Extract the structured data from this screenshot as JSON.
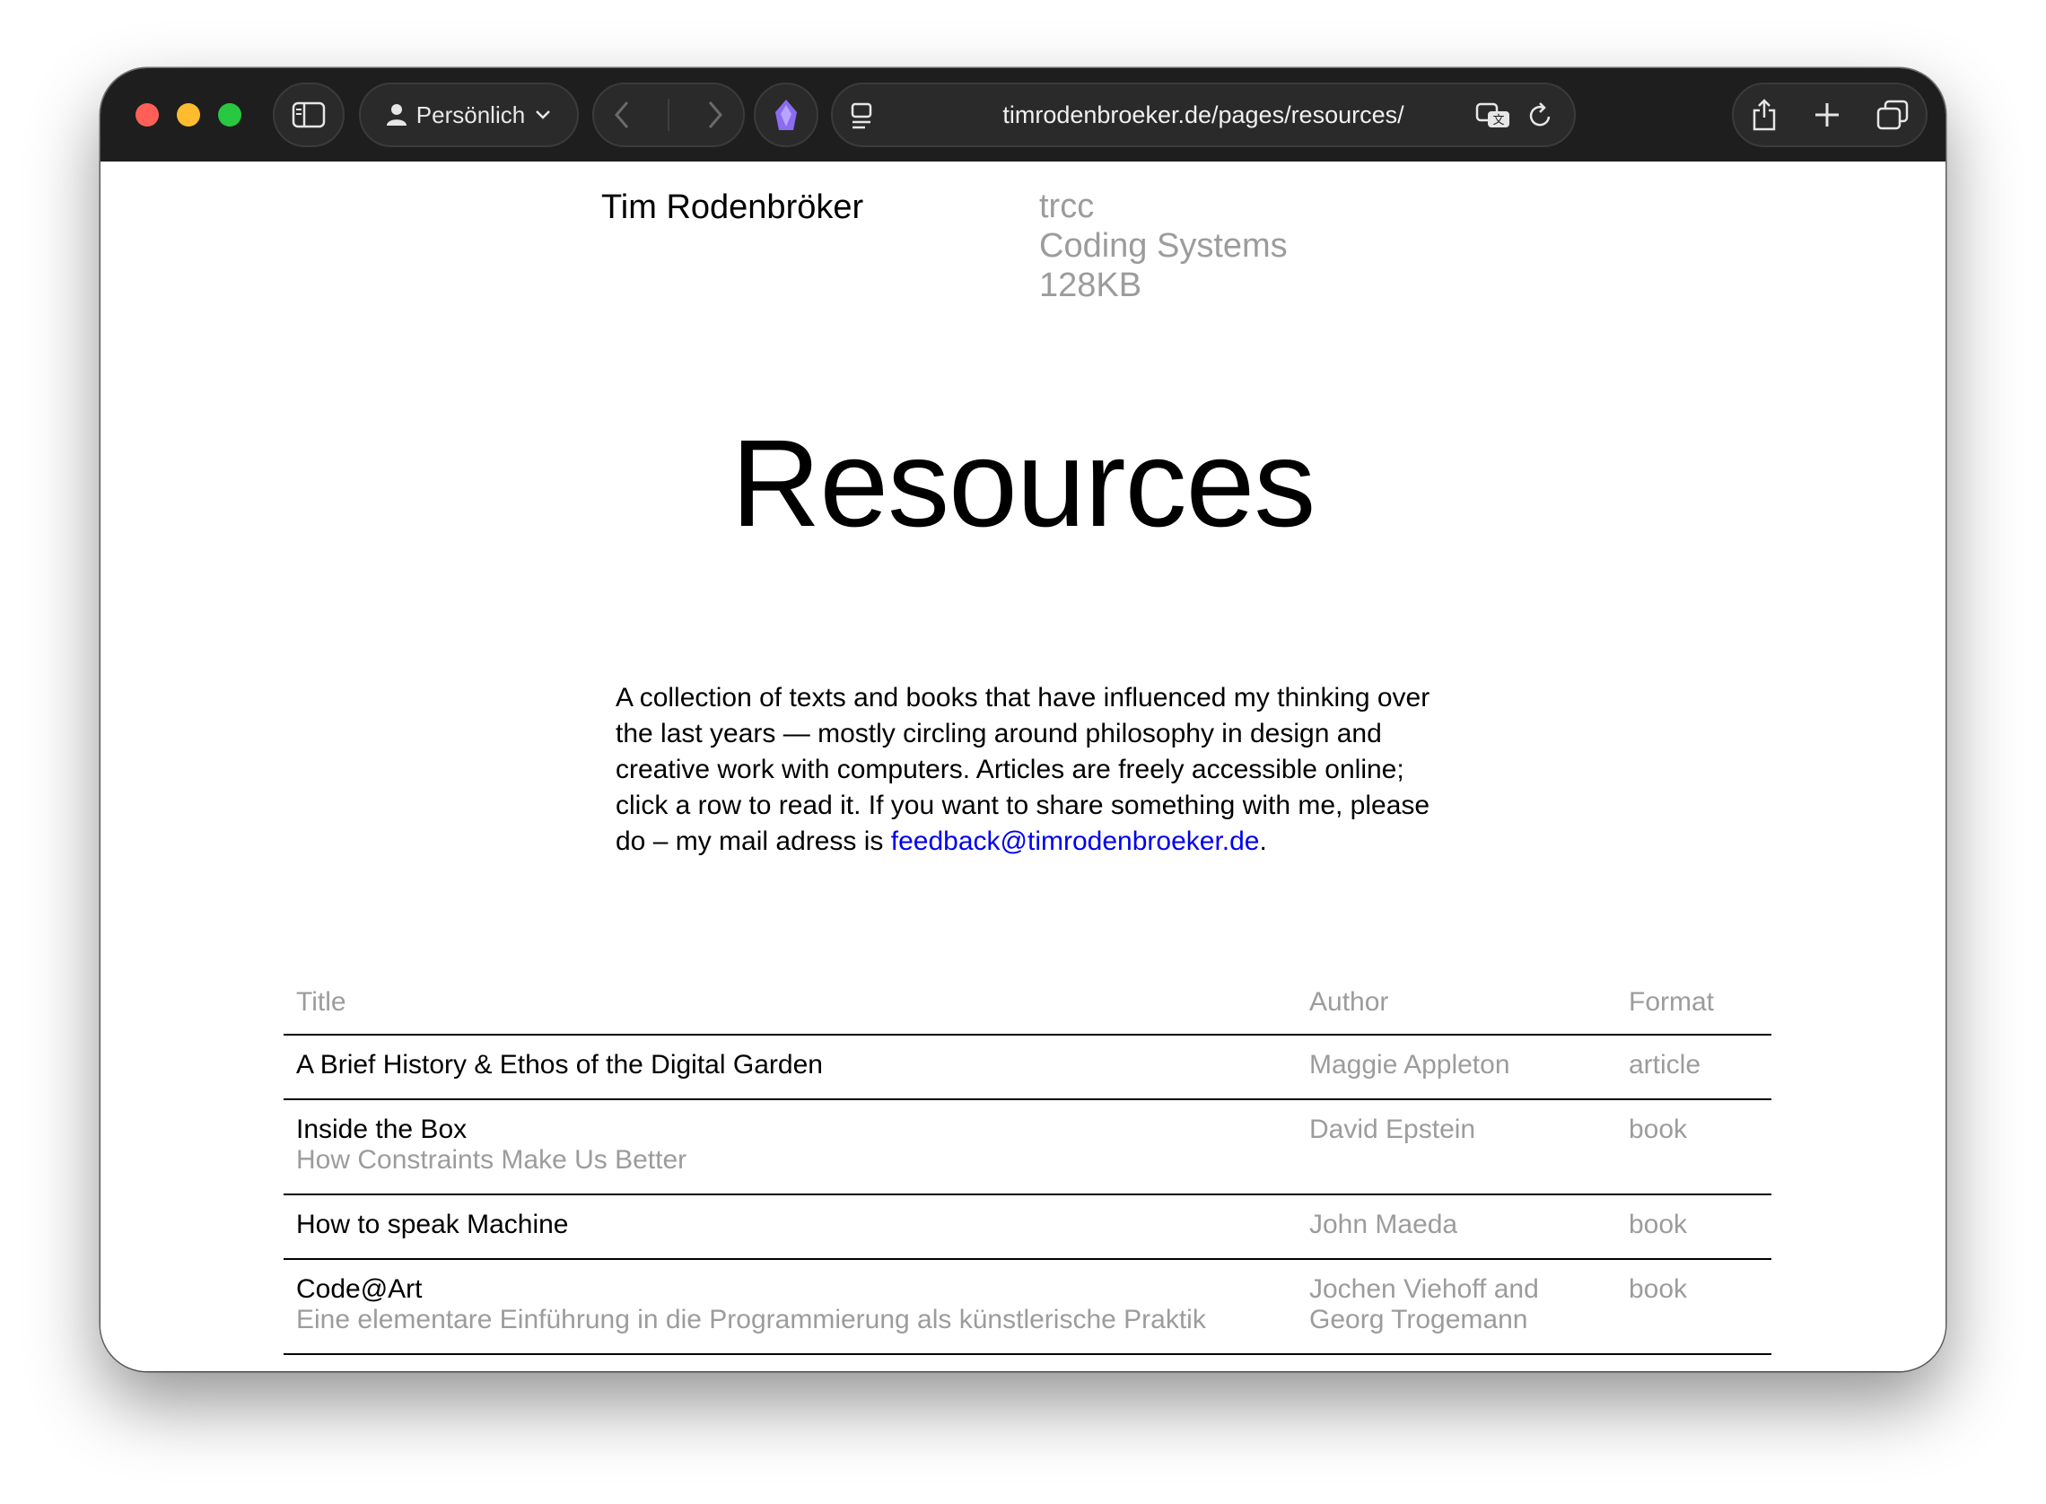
{
  "browser": {
    "profile_label": "Persönlich",
    "url": "timrodenbroeker.de/pages/resources/"
  },
  "site": {
    "name": "Tim Rodenbröker",
    "meta_lines": [
      "trcc",
      "Coding Systems",
      "128KB"
    ]
  },
  "page": {
    "heading": "Resources",
    "intro_text": "A collection of texts and books that have influenced my thinking over the last years — mostly circling around philosophy in design and creative work with computers. Articles are freely accessible online; click a row to read it. If you want to share something with me, please do – my mail adress is ",
    "intro_email": "feedback@timrodenbroeker.de",
    "intro_end": "."
  },
  "table": {
    "headers": {
      "title": "Title",
      "author": "Author",
      "format": "Format"
    },
    "rows": [
      {
        "title": "A Brief History & Ethos of the Digital Garden",
        "subtitle": "",
        "author": "Maggie Appleton",
        "format": "article"
      },
      {
        "title": "Inside the Box",
        "subtitle": "How Constraints Make Us Better",
        "author": "David Epstein",
        "format": "book"
      },
      {
        "title": "How to speak Machine",
        "subtitle": "",
        "author": "John Maeda",
        "format": "book"
      },
      {
        "title": "Code@Art",
        "subtitle": "Eine elementare Einführung in die Programmierung als künstlerische Praktik",
        "author_lines": [
          "Jochen Viehoff and",
          "Georg Trogemann"
        ],
        "format": "book"
      }
    ]
  }
}
